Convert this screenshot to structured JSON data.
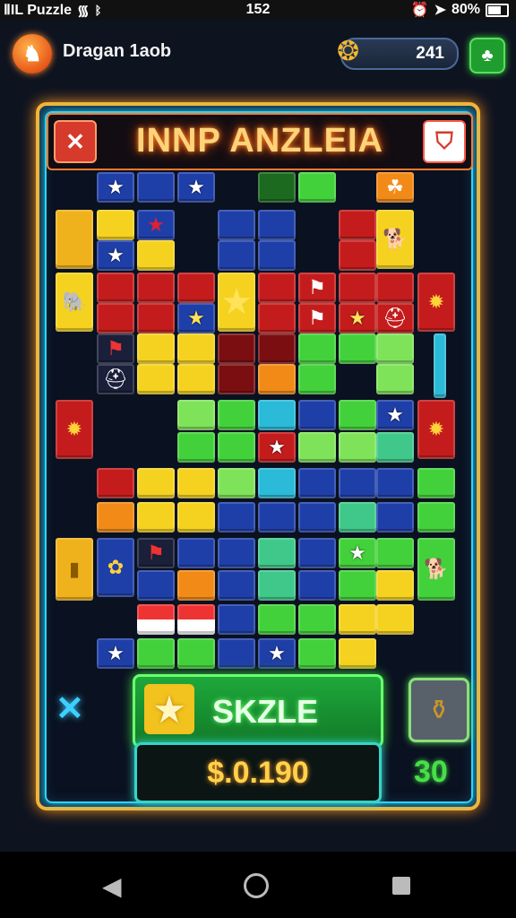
{
  "status": {
    "carrier": "ⅡIL Puzzle",
    "time": "152",
    "battery": "80%"
  },
  "profile": {
    "name": "Dragan 1aоb"
  },
  "coins": {
    "value": "241"
  },
  "title": "INNP ANZLEIA",
  "bottom": {
    "label": "SKZLE",
    "price": "$.0.190",
    "counter": "30"
  },
  "colors": {
    "board_border": "#f7b434",
    "inner_glow": "#2bd4ff",
    "title_glow": "#ff8a2a"
  }
}
